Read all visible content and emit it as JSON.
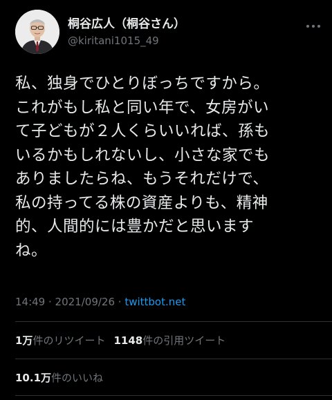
{
  "profile": {
    "display_name": "桐谷広人（桐谷さん）",
    "handle": "@kiritani1015_49"
  },
  "tweet": {
    "lines": [
      "私、独身でひとりぼっちですから。",
      "これがもし私と同い年で、女房がい",
      "て子どもが２人くらいいれば、孫も",
      "いるかもしれないし、小さな家でも",
      "ありましたらね、もうそれだけで、",
      "私の持ってる株の資産よりも、精神",
      "的、人間的には豊かだと思います",
      "ね。"
    ]
  },
  "meta": {
    "time": "14:49",
    "separator": " · ",
    "date": "2021/09/26",
    "source": "twittbot.net"
  },
  "stats": {
    "retweets_count": "1万",
    "retweets_label": "件のリツイート",
    "quotes_count": "1148",
    "quotes_label": "件の引用ツイート",
    "likes_count": "10.1万",
    "likes_label": "件のいいね"
  },
  "colors": {
    "background": "#000000",
    "text": "#e7e9ea",
    "muted": "#71767b",
    "link": "#1d9bf0",
    "divider": "#2f3336"
  },
  "icons": {
    "more": "more-horizontal-icon"
  }
}
